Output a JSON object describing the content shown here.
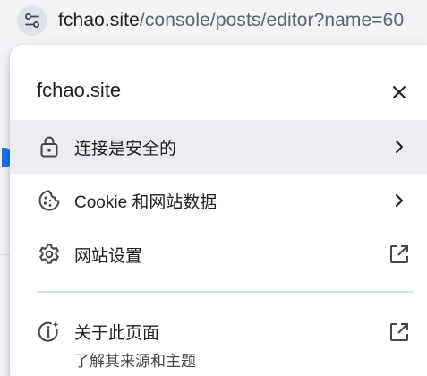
{
  "addressbar": {
    "host": "fchao.site",
    "path": "/console/posts/editor?name=60"
  },
  "popup": {
    "title": "fchao.site",
    "items": [
      {
        "label": "连接是安全的",
        "icon": "lock-icon",
        "trail": "chevron-right-icon"
      },
      {
        "label": "Cookie 和网站数据",
        "icon": "cookie-icon",
        "trail": "chevron-right-icon"
      },
      {
        "label": "网站设置",
        "icon": "gear-icon",
        "trail": "open-external-icon"
      },
      {
        "label": "关于此页面",
        "sublabel": "了解其来源和主题",
        "icon": "page-info-icon",
        "trail": "open-external-icon"
      }
    ]
  },
  "colors": {
    "accent": "#1a73e8",
    "hover_row": "#ebedf0",
    "divider": "#d3e3fd",
    "icon": "#444746"
  }
}
